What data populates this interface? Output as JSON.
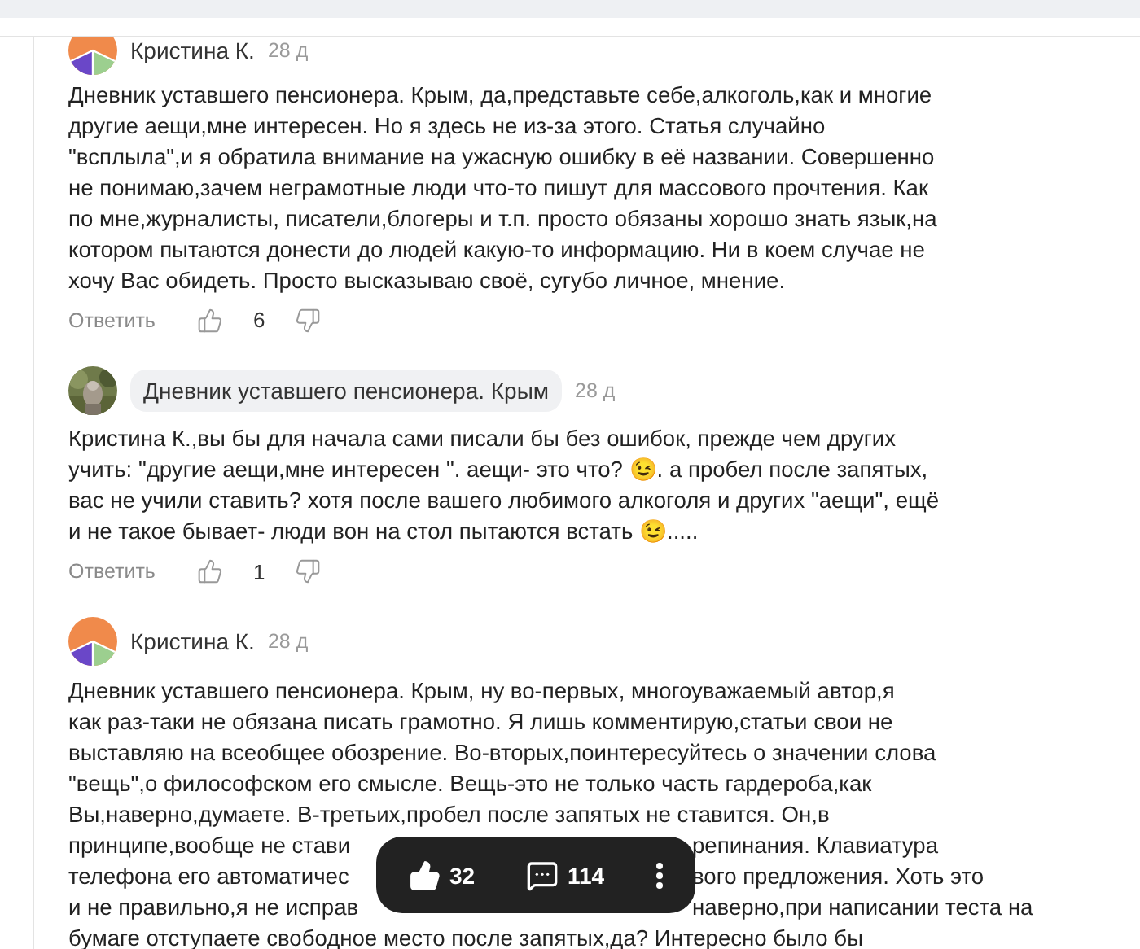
{
  "comments": [
    {
      "author": "Кристина К.",
      "author_badge": false,
      "avatar": {
        "kind": "logo"
      },
      "time": "28 д",
      "lines": [
        [
          "Дневник уставшего пенсионера. Крым, да,представьте себе,алкоголь,как и многие"
        ],
        [
          "другие аещи,мне интересен. Но я здесь не из-за этого. Статья случайно"
        ],
        [
          "\"всплыла\",и я обратила внимание на ужасную ошибку в её названии. Совершенно"
        ],
        [
          "не понимаю,зачем неграмотные люди что-то пишут для массового прочтения. Как"
        ],
        [
          "по мне,журналисты, писатели,блогеры и т.п. просто обязаны хорошо знать язык,на"
        ],
        [
          "котором пытаются донести до людей какую-то информацию. Ни в коем случае не"
        ],
        [
          "хочу Вас обидеть. Просто высказываю своё, сугубо личное, мнение."
        ]
      ],
      "reply": "Ответить",
      "likes": "6"
    },
    {
      "author": "Дневник уставшего пенсионера. Крым",
      "author_badge": true,
      "avatar": {
        "kind": "picture"
      },
      "time": "28 д",
      "lines": [
        [
          "Кристина К.,вы бы для начала сами писали бы без ошибок, прежде чем других"
        ],
        [
          "учить: \"другие аещи,мне интересен \". аещи- это что? 😉. а пробел после запятых,"
        ],
        [
          "вас не учили ставить? хотя после вашего любимого алкоголя и других \"аещи\", ещё"
        ],
        [
          "и не такое бывает- люди вон на стол пытаются встать 😉....."
        ]
      ],
      "reply": "Ответить",
      "likes": "1"
    },
    {
      "author": "Кристина К.",
      "author_badge": false,
      "avatar": {
        "kind": "logo"
      },
      "time": "28 д",
      "lines": [
        [
          "Дневник уставшего пенсионера. Крым, ну во-первых, многоуважаемый автор,я"
        ],
        [
          "как раз-таки не обязана писать грамотно. Я лишь комментирую,статьи свои не"
        ],
        [
          "выставляю на всеобщее обозрение. Во-вторых,поинтересуйтесь о значении слова"
        ],
        [
          "\"вещь\",о философском его смысле. Вещь-это не только часть гардероба,как"
        ],
        [
          "Вы,наверно,думаете. В-третьих,пробел после запятых не ставится. Он,в"
        ],
        [
          "принципе,вообще не стави",
          "репинания. Клавиатура"
        ],
        [
          "телефона его автоматичес",
          "вого предложения. Хоть это"
        ],
        [
          "и не правильно,я не исправ",
          "наверно,при написании теста на"
        ],
        [
          "бумаге отступаете свободное место после запятых,да? Интересно было бы"
        ]
      ]
    }
  ],
  "floating_bar": {
    "likes": "32",
    "comments": "114"
  }
}
